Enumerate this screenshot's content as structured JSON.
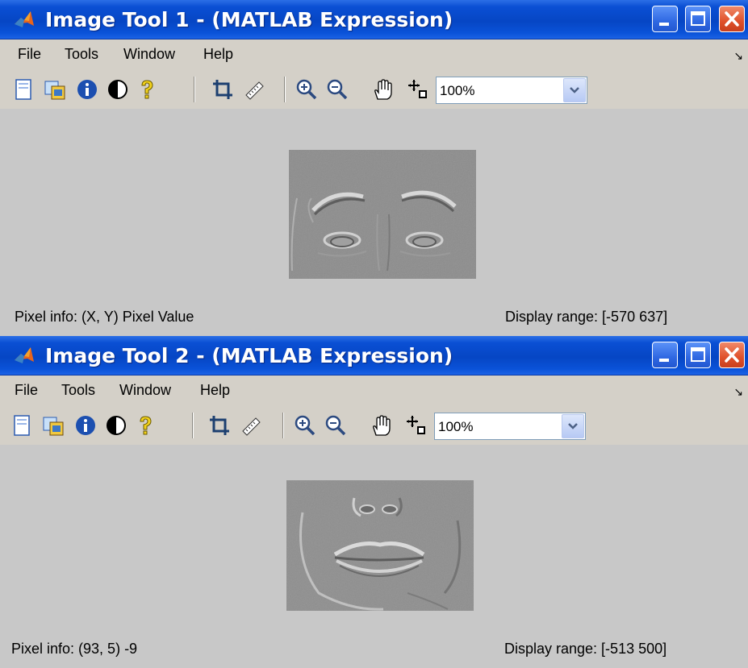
{
  "windows": [
    {
      "title": "Image Tool 1 - (MATLAB Expression)",
      "menu": [
        "File",
        "Tools",
        "Window",
        "Help"
      ],
      "zoom": "100%",
      "image_label": "face-eyes-image",
      "status_left": "Pixel info: (X, Y)  Pixel Value",
      "status_right": "Display range: [-570 637]"
    },
    {
      "title": "Image Tool 2 - (MATLAB Expression)",
      "menu": [
        "File",
        "Tools",
        "Window",
        "Help"
      ],
      "zoom": "100%",
      "image_label": "face-mouth-image",
      "status_left": "Pixel info: (93, 5)  -9",
      "status_right": "Display range: [-513 500]"
    }
  ],
  "toolbar_icons": [
    "new-figure-icon",
    "export-image-icon",
    "image-information-icon",
    "adjust-contrast-icon",
    "help-icon",
    "crop-image-icon",
    "measure-distance-icon",
    "zoom-in-icon",
    "zoom-out-icon",
    "pan-icon",
    "pixel-region-icon"
  ],
  "colors": {
    "titlebar": "#0a4fd4",
    "background": "#c8c8c8",
    "menubar": "#d4d0c8"
  }
}
